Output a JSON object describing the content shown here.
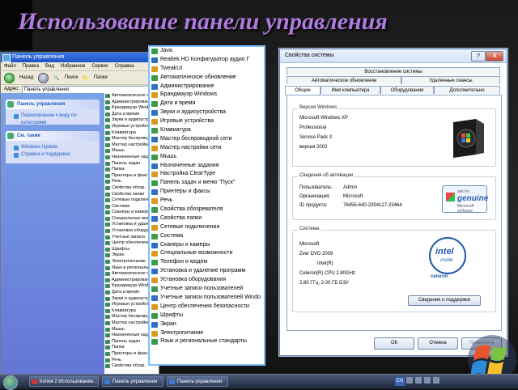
{
  "slide": {
    "title": "Использование панели управления"
  },
  "control_panel": {
    "window_title": "Панель управления",
    "menu": [
      "Файл",
      "Правка",
      "Вид",
      "Избранное",
      "Сервис",
      "Справка"
    ],
    "toolbar": {
      "back": "Назад",
      "search": "Поиск",
      "folders": "Папки"
    },
    "address_label": "Адрес:",
    "address_value": "Панель управления",
    "task_panel_title": "Панель управления",
    "task_panel_link": "Переключение к виду по категориям",
    "see_also_title": "См. также",
    "see_also_links": [
      "Windows Update",
      "Справка и поддержка"
    ],
    "items": [
      "Автоматическое обн",
      "Администрирование",
      "Брандмауэр Windo",
      "Дата и время",
      "Звуки и аудиоустр",
      "Игровые устройства",
      "Клавиатура",
      "Мастер беспроводн",
      "Мастер настройки",
      "Мышь",
      "Назначенные задания",
      "Панель задач",
      "Папка",
      "Принтеры и факсы",
      "Речь",
      "Свойства обозр.",
      "Свойства папки",
      "Сетевые подключения",
      "Система",
      "Сканеры и камеры",
      "Специальные возм.",
      "Установка и удаление",
      "Установка оборудов.",
      "Учетные записи",
      "Центр обеспечения",
      "Шрифты",
      "Экран",
      "Электропитание",
      "Язык и региональные",
      "Автоматическое обн",
      "Администрирование",
      "Брандмауэр Windo",
      "Дата и время",
      "Звуки и аудиоустр",
      "Игровые устройства",
      "Клавиатура",
      "Мастер беспроводн",
      "Мастер настройки",
      "Мышь",
      "Назначенные задания",
      "Панель задач",
      "Папка",
      "Принтеры и факсы",
      "Речь",
      "Свойства обозр."
    ]
  },
  "middle_list": {
    "items": [
      "Java",
      "Realtek HD Конфигуратор аудио Г",
      "TweakUI",
      "Автоматическое обновление",
      "Администрирование",
      "Брандмауэр Windows",
      "Дата и время",
      "Звуки и аудиоустройства",
      "Игровые устройства",
      "Клавиатура",
      "Мастер беспроводной сети",
      "Мастер настройки сети",
      "Мышь",
      "Назначенные задания",
      "Настройка ClearType",
      "Панель задач и меню \"Пуск\"",
      "Принтеры и факсы",
      "Речь",
      "Свойства обозревателя",
      "Свойства папки",
      "Сетевые подключения",
      "Система",
      "Сканеры и камеры",
      "Специальные возможности",
      "Телефон и модем",
      "Установка и удаление программ",
      "Установка оборудования",
      "Учетные записи пользователей",
      "Учетные записи пользователей Windo",
      "Центр обеспечения безопасности",
      "Шрифты",
      "Экран",
      "Электропитание",
      "Язык и региональные стандарты"
    ]
  },
  "system_dialog": {
    "title": "Свойства системы",
    "tabs_row1": [
      "Восстановление системы"
    ],
    "tabs_row2": [
      "Автоматическое обновление",
      "Удаленные сеансы"
    ],
    "tabs_row3": [
      "Общие",
      "Имя компьютера",
      "Оборудование",
      "Дополнительно"
    ],
    "windows_group": "Версия Windows",
    "windows_lines": [
      "Microsoft Windows XP",
      "Professional",
      "Service Pack 3",
      "версия 2002"
    ],
    "activation_group": "Сведения об активации",
    "activation_rows": [
      {
        "label": "Пользователь:",
        "value": "Admin"
      },
      {
        "label": "Организация:",
        "value": "Microsoft"
      },
      {
        "label": "ID продукта:",
        "value": "76456-640-2394127-23464"
      }
    ],
    "genuine": {
      "top": "ask for",
      "main": "genuine",
      "bottom": "Microsoft software"
    },
    "system_group": "Система",
    "system_lines": [
      "Microsoft",
      "Zver DVD 2009",
      "Intel(R)",
      "Celeron(R) CPU 2.80GHz",
      "2.80 ГГц, 2.00 ГБ ОЗУ"
    ],
    "intel": {
      "brand": "intel",
      "inside": "inside",
      "model": "celeron"
    },
    "support_button": "Сведения о поддержке",
    "ok": "ОК",
    "cancel": "Отмена",
    "apply": "Применить"
  },
  "taskbar": {
    "items": [
      "Копия 2 Использование...",
      "Панель управления",
      "Панель управления"
    ],
    "lang": "EN"
  }
}
